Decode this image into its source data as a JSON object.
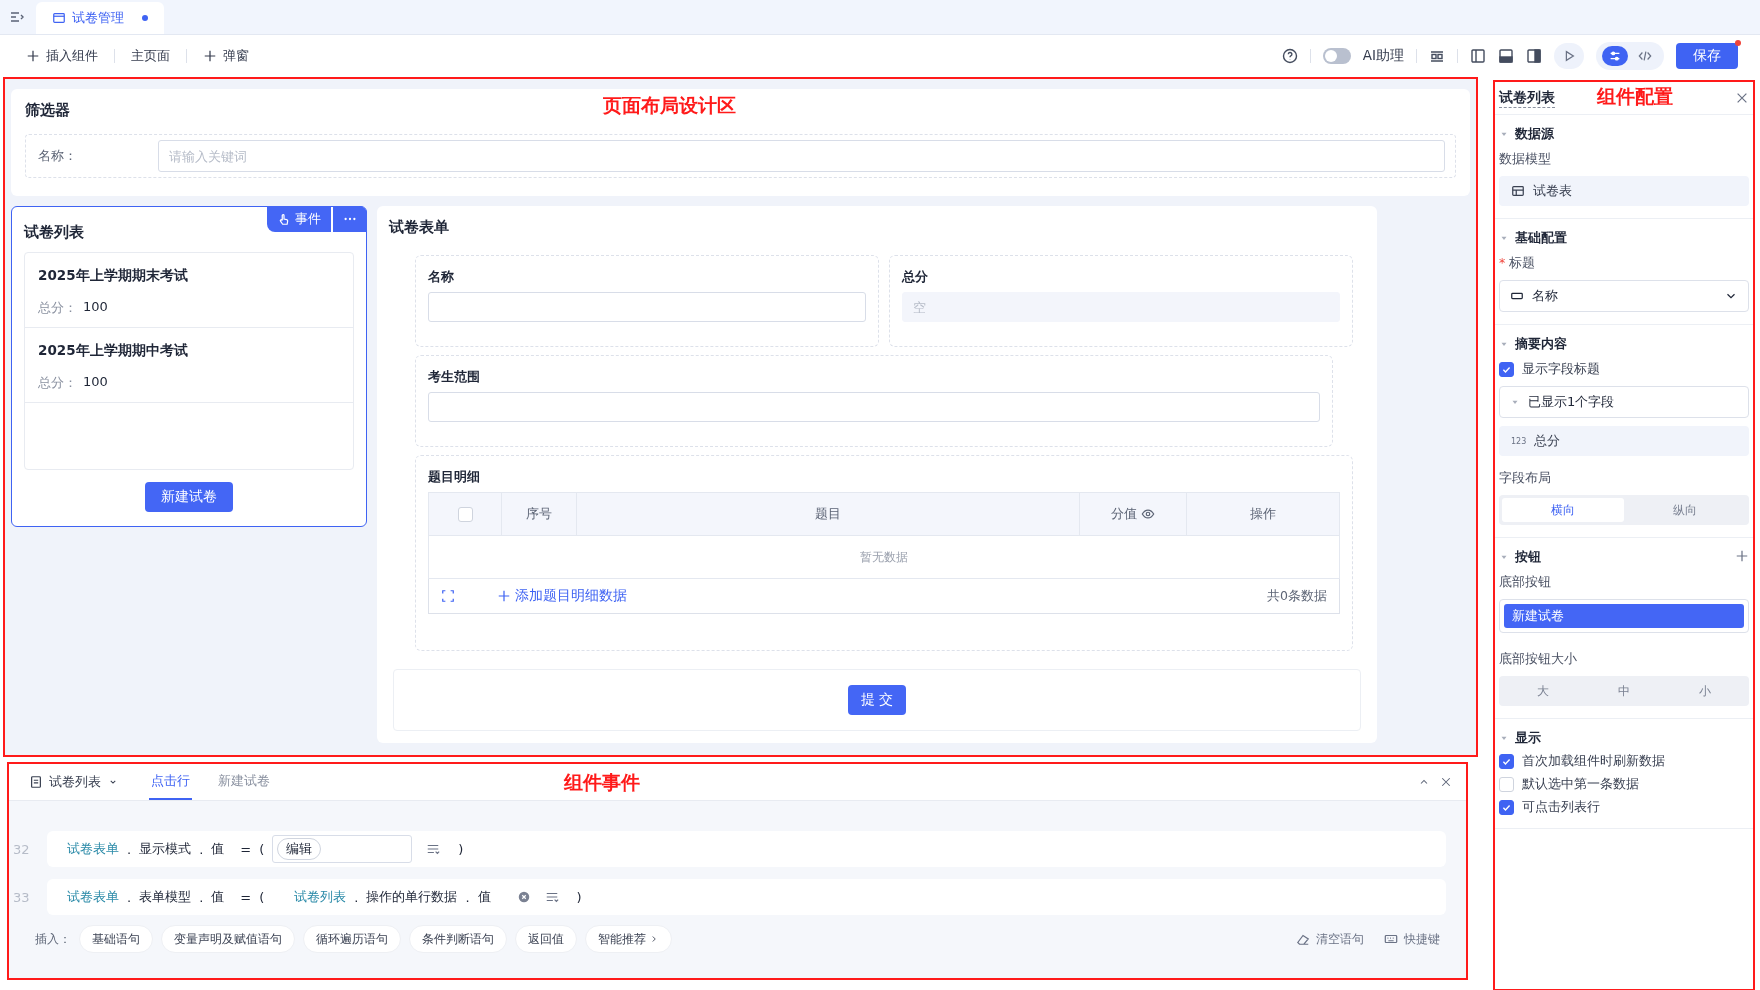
{
  "tab_bar": {
    "tabs": [
      {
        "label": "试卷管理",
        "selected": true,
        "unsaved": true
      }
    ]
  },
  "toolbar": {
    "actions": [
      {
        "label": "插入组件",
        "kind": "add"
      },
      {
        "label": "主页面",
        "kind": "page"
      },
      {
        "label": "弹窗",
        "kind": "add"
      }
    ],
    "ai_assistant": {
      "label": "AI助理",
      "on": false
    },
    "view_modes": [
      {
        "kind": "settings",
        "selected": true
      },
      {
        "kind": "code",
        "selected": false
      }
    ],
    "save": {
      "label": "保存",
      "badge": true
    }
  },
  "design_area": {
    "annotation": "页面布局设计区",
    "filter": {
      "title": "筛选器",
      "field_label": "名称：",
      "placeholder": "请输入关键词"
    },
    "list": {
      "title": "试卷列表",
      "selected": true,
      "event_button": "事件",
      "items": [
        {
          "title": "2025年上学期期末考试",
          "score_label": "总分：",
          "score": "100"
        },
        {
          "title": "2025年上学期期中考试",
          "score_label": "总分：",
          "score": "100"
        }
      ],
      "button": "新建试卷"
    },
    "form": {
      "title": "试卷表单",
      "fields": [
        {
          "label": "名称",
          "disabled": false
        },
        {
          "label": "总分",
          "placeholder": "空",
          "disabled": true
        }
      ],
      "wide_field": {
        "label": "考生范围"
      },
      "table": {
        "label": "题目明细",
        "columns": [
          {
            "kind": "checkbox",
            "checked": false
          },
          {
            "kind": "text",
            "label": "序号"
          },
          {
            "kind": "text",
            "label": "题目"
          },
          {
            "kind": "eye",
            "label": "分值"
          },
          {
            "kind": "text",
            "label": "操作"
          }
        ],
        "empty": "暂无数据",
        "add": "添加题目明细数据",
        "count": "共0条数据"
      },
      "submit": "提 交"
    }
  },
  "event_panel": {
    "annotation": "组件事件",
    "component": "试卷列表",
    "tabs": [
      {
        "label": "点击行",
        "selected": true
      },
      {
        "label": "新建试卷",
        "selected": false
      }
    ],
    "lines": [
      {
        "number": "32",
        "target": [
          "试卷表单",
          "显示模式",
          "值"
        ],
        "separator": ".",
        "operator": "=",
        "open": "(",
        "value": {
          "kind": "tag",
          "text": "编辑"
        },
        "close": ")"
      },
      {
        "number": "33",
        "target": [
          "试卷表单",
          "表单模型",
          "值"
        ],
        "separator": ".",
        "operator": "=",
        "open": "(",
        "value": {
          "kind": "ref",
          "parts": [
            "试卷列表",
            "操作的单行数据",
            "值"
          ]
        },
        "close": ")"
      }
    ],
    "insert_label": "插入：",
    "chips": [
      {
        "label": "基础语句",
        "more": false
      },
      {
        "label": "变量声明及赋值语句",
        "more": false
      },
      {
        "label": "循环遍历语句",
        "more": false
      },
      {
        "label": "条件判断语句",
        "more": false
      },
      {
        "label": "返回值",
        "more": false
      },
      {
        "label": "智能推荐",
        "more": true
      }
    ],
    "actions": [
      {
        "label": "清空语句",
        "kind": "eraser"
      },
      {
        "label": "快捷键",
        "kind": "keyboard"
      }
    ]
  },
  "config_panel": {
    "title": "试卷列表",
    "annotation": "组件配置",
    "data_source": {
      "title": "数据源",
      "label": "数据模型",
      "value": "试卷表"
    },
    "basic": {
      "title": "基础配置",
      "required": "*",
      "label": "标题",
      "value": "名称"
    },
    "summary": {
      "title": "摘要内容",
      "show_title": {
        "label": "显示字段标题",
        "checked": true
      },
      "group": "已显示1个字段",
      "field": {
        "badge": "123",
        "label": "总分"
      },
      "layout_label": "字段布局",
      "layout": [
        {
          "label": "横向",
          "selected": true
        },
        {
          "label": "纵向",
          "selected": false
        }
      ]
    },
    "buttons": {
      "title": "按钮",
      "label": "底部按钮",
      "button": "新建试卷",
      "size_label": "底部按钮大小",
      "sizes": [
        {
          "label": "大",
          "selected": false
        },
        {
          "label": "中",
          "selected": false
        },
        {
          "label": "小",
          "selected": false
        }
      ]
    },
    "display": {
      "title": "显示",
      "options": [
        {
          "label": "首次加载组件时刷新数据",
          "checked": true
        },
        {
          "label": "默认选中第一条数据",
          "checked": false
        },
        {
          "label": "可点击列表行",
          "checked": true
        }
      ]
    }
  }
}
